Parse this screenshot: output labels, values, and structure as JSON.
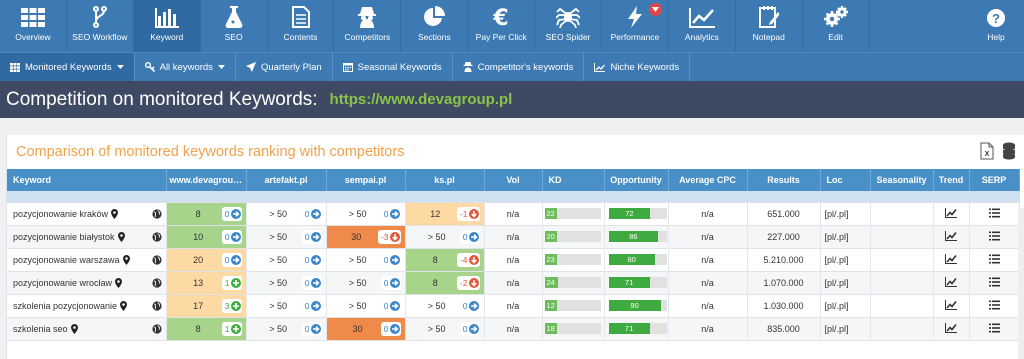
{
  "nav": [
    {
      "label": "Overview",
      "icon": "grid-icon"
    },
    {
      "label": "SEO Workflow",
      "icon": "workflow-icon"
    },
    {
      "label": "Keyword",
      "icon": "bar-chart-icon",
      "active": true
    },
    {
      "label": "SEO",
      "icon": "flask-icon"
    },
    {
      "label": "Contents",
      "icon": "document-icon"
    },
    {
      "label": "Competitors",
      "icon": "spy-icon"
    },
    {
      "label": "Sections",
      "icon": "pie-chart-icon"
    },
    {
      "label": "Pay Per Click",
      "icon": "euro-icon"
    },
    {
      "label": "SEO Spider",
      "icon": "spider-icon"
    },
    {
      "label": "Performance",
      "icon": "lightning-icon",
      "badge": true
    },
    {
      "label": "Analytics",
      "icon": "line-chart-icon"
    },
    {
      "label": "Notepad",
      "icon": "notepad-icon"
    },
    {
      "label": "Edit",
      "icon": "gears-icon"
    }
  ],
  "help_label": "Help",
  "subnav": [
    {
      "label": "Monitored Keywords",
      "caret": true,
      "active": true
    },
    {
      "label": "All keywords",
      "caret": true
    },
    {
      "label": "Quarterly Plan"
    },
    {
      "label": "Seasonal Keywords"
    },
    {
      "label": "Competitor's keywords"
    },
    {
      "label": "Niche Keywords"
    }
  ],
  "title": "Competition on monitored Keywords:",
  "url": "https://www.devagroup.pl",
  "panel_title": "Comparison of monitored keywords ranking with competitors",
  "columns": [
    "Keyword",
    "www.devagroup.pl",
    "artefakt.pl",
    "sempai.pl",
    "ks.pl",
    "Vol",
    "KD",
    "Opportunity",
    "Average CPC",
    "Results",
    "Loc",
    "Seasonality",
    "Trend",
    "SERP"
  ],
  "rows": [
    {
      "keyword": "pozycjonowanie kraków",
      "ranks": [
        {
          "v": "8",
          "d": "0",
          "c": "green",
          "t": "up"
        },
        {
          "v": "> 50",
          "d": "0",
          "c": "",
          "t": "up"
        },
        {
          "v": "> 50",
          "d": "0",
          "c": "",
          "t": "up"
        },
        {
          "v": "12",
          "d": "-1",
          "c": "yellow",
          "t": "down"
        }
      ],
      "vol": "n/a",
      "kd": 22,
      "opp": 72,
      "cpc": "n/a",
      "results": "651.000",
      "loc": "[pl/.pl]"
    },
    {
      "keyword": "pozycjonowanie białystok",
      "ranks": [
        {
          "v": "10",
          "d": "0",
          "c": "green",
          "t": "up"
        },
        {
          "v": "> 50",
          "d": "0",
          "c": "",
          "t": "up"
        },
        {
          "v": "30",
          "d": "-3",
          "c": "orange",
          "t": "down"
        },
        {
          "v": "> 50",
          "d": "0",
          "c": "",
          "t": "up"
        }
      ],
      "vol": "n/a",
      "kd": 20,
      "opp": 86,
      "cpc": "n/a",
      "results": "227.000",
      "loc": "[pl/.pl]"
    },
    {
      "keyword": "pozycjonowanie warszawa",
      "ranks": [
        {
          "v": "20",
          "d": "0",
          "c": "yellow",
          "t": "up"
        },
        {
          "v": "> 50",
          "d": "0",
          "c": "",
          "t": "up"
        },
        {
          "v": "> 50",
          "d": "0",
          "c": "",
          "t": "up"
        },
        {
          "v": "8",
          "d": "-4",
          "c": "green",
          "t": "down"
        }
      ],
      "vol": "n/a",
      "kd": 23,
      "opp": 80,
      "cpc": "n/a",
      "results": "5.210.000",
      "loc": "[pl/.pl]"
    },
    {
      "keyword": "pozycjonowanie wrocław",
      "ranks": [
        {
          "v": "13",
          "d": "1",
          "c": "yellow",
          "t": "plus"
        },
        {
          "v": "> 50",
          "d": "0",
          "c": "",
          "t": "up"
        },
        {
          "v": "> 50",
          "d": "0",
          "c": "",
          "t": "up"
        },
        {
          "v": "8",
          "d": "-2",
          "c": "green",
          "t": "down"
        }
      ],
      "vol": "n/a",
      "kd": 24,
      "opp": 71,
      "cpc": "n/a",
      "results": "1.070.000",
      "loc": "[pl/.pl]"
    },
    {
      "keyword": "szkolenia pozycjonowanie",
      "ranks": [
        {
          "v": "17",
          "d": "3",
          "c": "yellow",
          "t": "plus"
        },
        {
          "v": "> 50",
          "d": "0",
          "c": "",
          "t": "up"
        },
        {
          "v": "> 50",
          "d": "0",
          "c": "",
          "t": "up"
        },
        {
          "v": "> 50",
          "d": "0",
          "c": "",
          "t": "up"
        }
      ],
      "vol": "n/a",
      "kd": 12,
      "opp": 90,
      "cpc": "n/a",
      "results": "1.030.000",
      "loc": "[pl/.pl]"
    },
    {
      "keyword": "szkolenia seo",
      "ranks": [
        {
          "v": "8",
          "d": "1",
          "c": "green",
          "t": "plus"
        },
        {
          "v": "> 50",
          "d": "0",
          "c": "",
          "t": "up"
        },
        {
          "v": "30",
          "d": "0",
          "c": "orange",
          "t": "up"
        },
        {
          "v": "> 50",
          "d": "0",
          "c": "",
          "t": "up"
        }
      ],
      "vol": "n/a",
      "kd": 18,
      "opp": 71,
      "cpc": "n/a",
      "results": "835.000",
      "loc": "[pl/.pl]"
    }
  ],
  "colors": {
    "nav_bg": "#3d7ab3",
    "title_bg": "#3e4a63",
    "url": "#8bc34a",
    "panel_title": "#f0a24a",
    "header_bg": "#4a90c8",
    "rank_green": "#a5d48a",
    "rank_yellow": "#fdd9a3",
    "rank_orange": "#f08a4a"
  }
}
